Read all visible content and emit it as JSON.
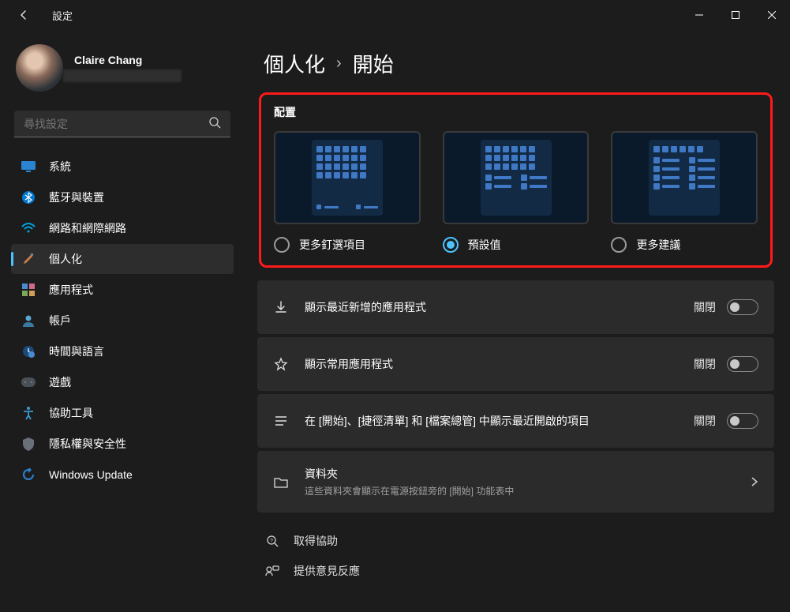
{
  "window": {
    "title": "設定"
  },
  "user": {
    "name": "Claire Chang"
  },
  "search": {
    "placeholder": "尋找設定"
  },
  "sidebar": {
    "items": [
      {
        "label": "系統",
        "icon": "monitor"
      },
      {
        "label": "藍牙與裝置",
        "icon": "bluetooth"
      },
      {
        "label": "網路和網際網路",
        "icon": "wifi"
      },
      {
        "label": "個人化",
        "icon": "brush",
        "active": true
      },
      {
        "label": "應用程式",
        "icon": "apps"
      },
      {
        "label": "帳戶",
        "icon": "account"
      },
      {
        "label": "時間與語言",
        "icon": "time"
      },
      {
        "label": "遊戲",
        "icon": "game"
      },
      {
        "label": "協助工具",
        "icon": "accessibility"
      },
      {
        "label": "隱私權與安全性",
        "icon": "shield"
      },
      {
        "label": "Windows Update",
        "icon": "update"
      }
    ]
  },
  "breadcrumb": {
    "parent": "個人化",
    "current": "開始"
  },
  "layout_section": {
    "title": "配置",
    "options": [
      {
        "label": "更多釘選項目",
        "selected": false
      },
      {
        "label": "預設值",
        "selected": true
      },
      {
        "label": "更多建議",
        "selected": false
      }
    ]
  },
  "rows": [
    {
      "icon": "download",
      "label": "顯示最近新增的應用程式",
      "state": "關閉",
      "toggle": false
    },
    {
      "icon": "star",
      "label": "顯示常用應用程式",
      "state": "關閉",
      "toggle": false
    },
    {
      "icon": "list",
      "label": "在 [開始]、[捷徑清單] 和 [檔案總管] 中顯示最近開啟的項目",
      "state": "關閉",
      "toggle": false
    },
    {
      "icon": "folder",
      "label": "資料夾",
      "desc": "這些資料夾會顯示在電源按鈕旁的 [開始] 功能表中",
      "chevron": true
    }
  ],
  "footer": {
    "help": "取得協助",
    "feedback": "提供意見反應"
  }
}
